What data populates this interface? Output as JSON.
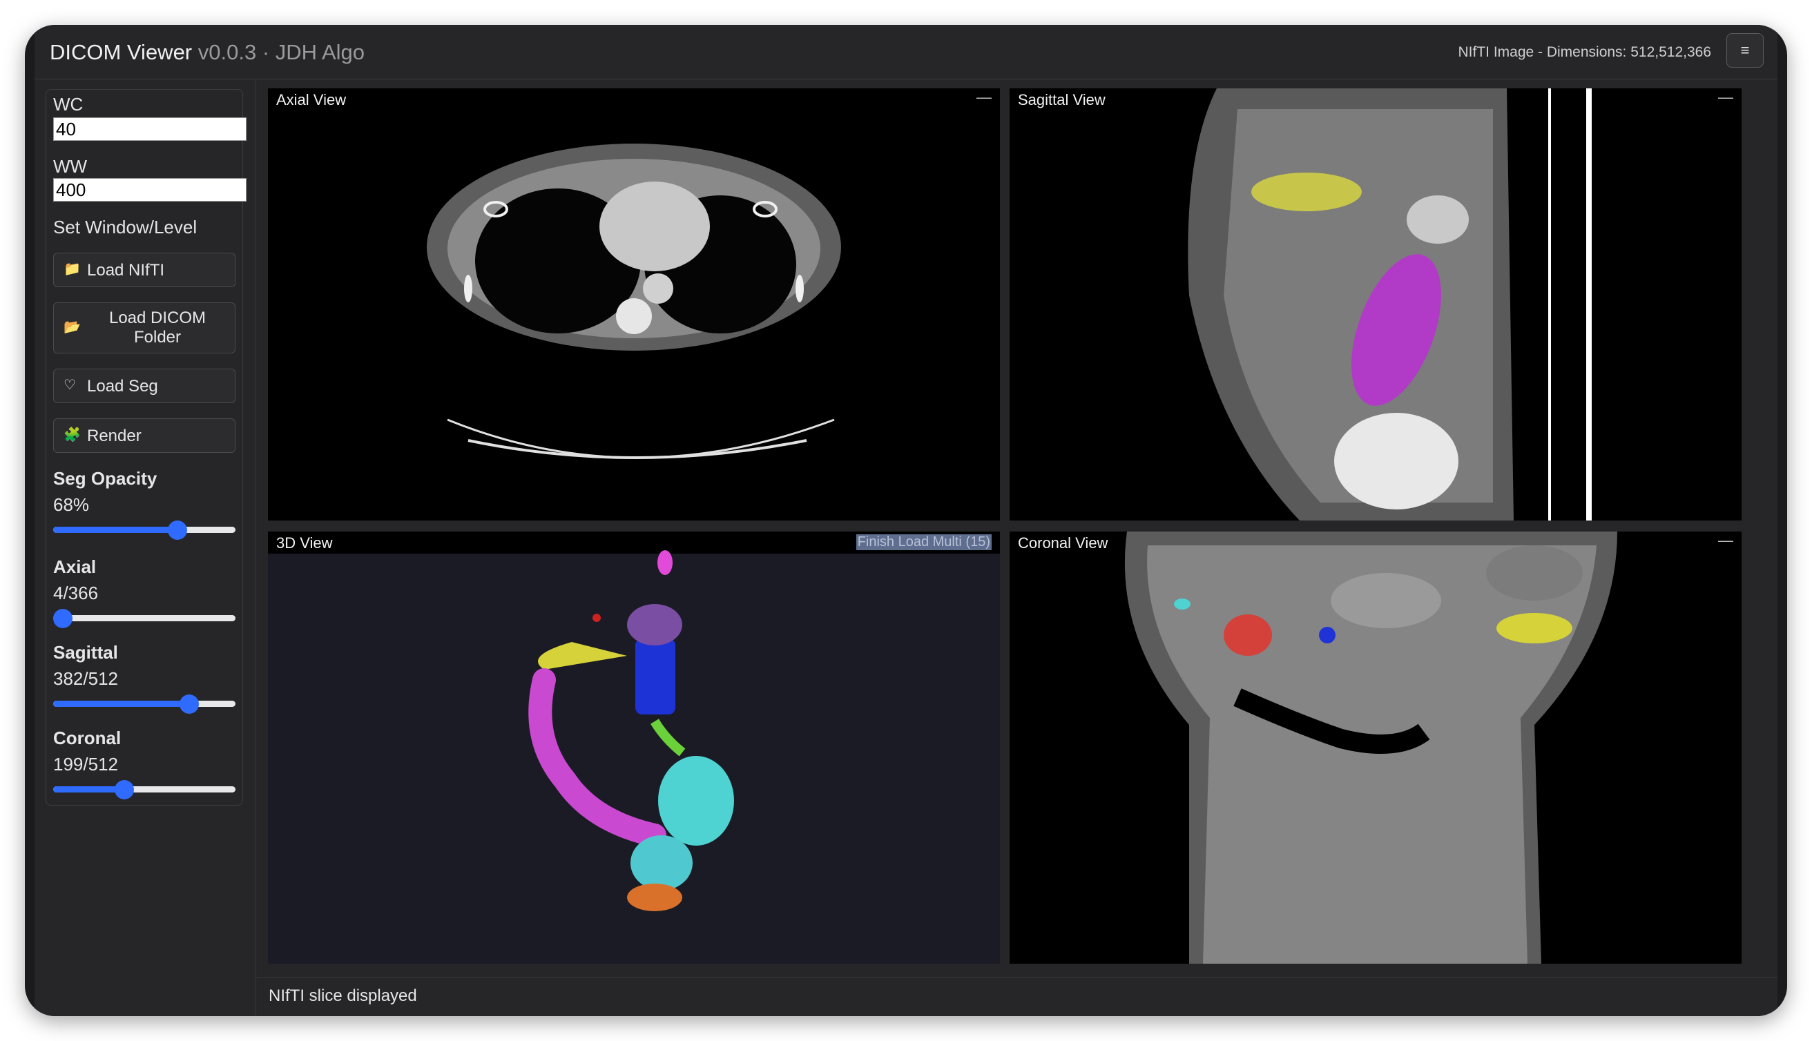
{
  "app": {
    "title": "DICOM Viewer",
    "version": "v0.0.3 · JDH Algo",
    "image_info": "NIfTI Image - Dimensions: 512,512,366",
    "menu_icon": "≡"
  },
  "sidebar": {
    "wc_label": "WC",
    "wc_value": "40",
    "ww_label": "WW",
    "ww_value": "400",
    "set_window_label": "Set Window/Level",
    "buttons": [
      {
        "icon": "folder-icon",
        "glyph": "📁",
        "label": "Load NIfTI"
      },
      {
        "icon": "folder-icon",
        "glyph": "📂",
        "label": "Load DICOM Folder"
      },
      {
        "icon": "seg-icon",
        "glyph": "♡",
        "label": "Load Seg"
      },
      {
        "icon": "puzzle-icon",
        "glyph": "🧩",
        "label": "Render"
      }
    ],
    "seg_opacity": {
      "label": "Seg Opacity",
      "value": "68%",
      "fraction": 0.68
    },
    "axial": {
      "label": "Axial",
      "value": "4/366",
      "fraction": 0.011
    },
    "sagittal": {
      "label": "Sagittal",
      "value": "382/512",
      "fraction": 0.746
    },
    "coronal": {
      "label": "Coronal",
      "value": "199/512",
      "fraction": 0.389
    }
  },
  "views": {
    "axial": {
      "title": "Axial View",
      "minimize": "—"
    },
    "sagittal": {
      "title": "Sagittal View",
      "minimize": "—"
    },
    "threed": {
      "title": "3D View",
      "badge": "Finish Load Multi (15)"
    },
    "coronal": {
      "title": "Coronal View",
      "minimize": "—"
    }
  },
  "status": {
    "text": "NIfTI slice displayed"
  },
  "colors": {
    "accent": "#2f6bff",
    "background": "#262628",
    "view_bg": "#000000",
    "threed_bg": "#1a1a24"
  }
}
